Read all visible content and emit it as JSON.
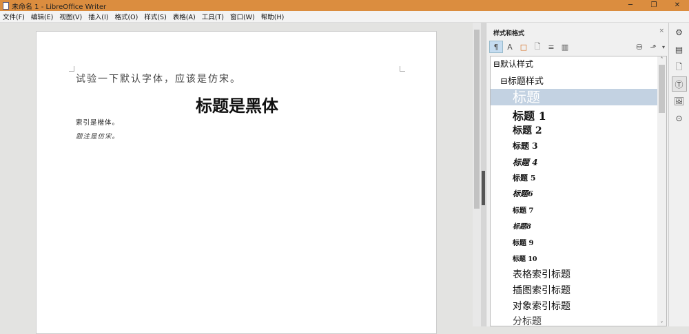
{
  "window": {
    "title": "未命名 1 - LibreOffice Writer",
    "minimize": "─",
    "restore": "❐",
    "close": "✕"
  },
  "menu": [
    "文件(F)",
    "编辑(E)",
    "视图(V)",
    "插入(I)",
    "格式(O)",
    "样式(S)",
    "表格(A)",
    "工具(T)",
    "窗口(W)",
    "帮助(H)"
  ],
  "document": {
    "p1": "试验一下默认字体，应该是仿宋。",
    "heading": "标题是黑体",
    "p2": "索引是楷体。",
    "p3": "题注是仿宋。"
  },
  "sidebar": {
    "title": "样式和格式",
    "close": "×",
    "toolbar": [
      "¶",
      "A",
      "□",
      "🗋",
      "≡",
      "▥"
    ],
    "toolbar_right": [
      "⛁",
      "⬏",
      "▾"
    ],
    "items": [
      {
        "label": "⊟默认样式"
      },
      {
        "label": "⊟标题样式"
      },
      {
        "label": "标题"
      },
      {
        "label": "标题 1"
      },
      {
        "label": "标题 2"
      },
      {
        "label": "标题 3"
      },
      {
        "label": "标题 4"
      },
      {
        "label": "标题 5"
      },
      {
        "label": "标题6"
      },
      {
        "label": "标题 7"
      },
      {
        "label": "标题8"
      },
      {
        "label": "标题 9"
      },
      {
        "label": "标题 10"
      },
      {
        "label": "表格索引标题"
      },
      {
        "label": "插图索引标题"
      },
      {
        "label": "对象索引标题"
      },
      {
        "label": "分标题"
      }
    ],
    "scroll_up": "˄",
    "scroll_down": "˅"
  },
  "tabbar": [
    "⚙",
    "▤",
    "🗋",
    "Ⓣ",
    "🖼",
    "⊙"
  ]
}
